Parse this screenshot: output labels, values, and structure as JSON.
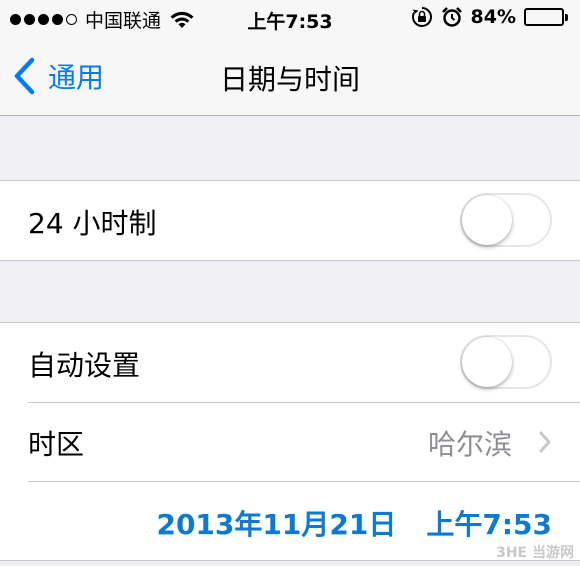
{
  "status_bar": {
    "signal_dots": 5,
    "signal_filled": 4,
    "carrier": "中国联通",
    "wifi_icon": "wifi-icon",
    "time": "上午7:53",
    "rotation_lock_icon": "rotation-lock-icon",
    "alarm_icon": "alarm-icon",
    "battery_percent": "84%",
    "battery_level": 0.84
  },
  "nav": {
    "back_label": "通用",
    "title": "日期与时间",
    "accent_color": "#007aff"
  },
  "settings": {
    "hour24": {
      "label": "24 小时制",
      "on": false
    },
    "auto_set": {
      "label": "自动设置",
      "on": false
    },
    "timezone": {
      "label": "时区",
      "value": "哈尔滨"
    },
    "current_date": "2013年11月21日",
    "current_time": "上午7:53",
    "datetime_color": "#0a7ad6"
  },
  "watermark": "3HE 当游网"
}
